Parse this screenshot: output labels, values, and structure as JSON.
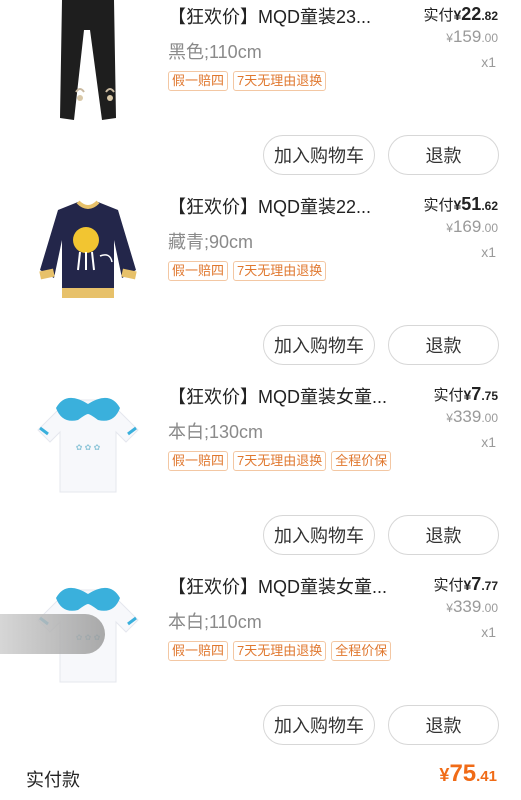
{
  "items": [
    {
      "title": "【狂欢价】MQD童装23...",
      "spec": "黑色;110cm",
      "tags": [
        "假一赔四",
        "7天无理由退换"
      ],
      "actual_label": "实付",
      "actual_symbol": "¥",
      "actual_int": "22",
      "actual_dec": ".82",
      "orig_symbol": "¥",
      "orig_int": "159",
      "orig_dec": ".00",
      "qty": "x1",
      "cart_label": "加入购物车",
      "refund_label": "退款"
    },
    {
      "title": "【狂欢价】MQD童装22...",
      "spec": "藏青;90cm",
      "tags": [
        "假一赔四",
        "7天无理由退换"
      ],
      "actual_label": "实付",
      "actual_symbol": "¥",
      "actual_int": "51",
      "actual_dec": ".62",
      "orig_symbol": "¥",
      "orig_int": "169",
      "orig_dec": ".00",
      "qty": "x1",
      "cart_label": "加入购物车",
      "refund_label": "退款"
    },
    {
      "title": "【狂欢价】MQD童装女童...",
      "spec": "本白;130cm",
      "tags": [
        "假一赔四",
        "7天无理由退换",
        "全程价保"
      ],
      "actual_label": "实付",
      "actual_symbol": "¥",
      "actual_int": "7",
      "actual_dec": ".75",
      "orig_symbol": "¥",
      "orig_int": "339",
      "orig_dec": ".00",
      "qty": "x1",
      "cart_label": "加入购物车",
      "refund_label": "退款"
    },
    {
      "title": "【狂欢价】MQD童装女童...",
      "spec": "本白;110cm",
      "tags": [
        "假一赔四",
        "7天无理由退换",
        "全程价保"
      ],
      "actual_label": "实付",
      "actual_symbol": "¥",
      "actual_int": "7",
      "actual_dec": ".77",
      "orig_symbol": "¥",
      "orig_int": "339",
      "orig_dec": ".00",
      "qty": "x1",
      "cart_label": "加入购物车",
      "refund_label": "退款"
    }
  ],
  "footer": {
    "label": "实付款",
    "symbol": "¥",
    "int": "75",
    "dec": ".41"
  },
  "colors": {
    "accent": "#f06b17",
    "tag_text": "#e0782f",
    "tag_border": "#f3c7a3"
  },
  "icons": [
    "leggings-thumbnail",
    "sweater-thumbnail",
    "collar-shirt-thumbnail",
    "collar-shirt-thumbnail"
  ]
}
